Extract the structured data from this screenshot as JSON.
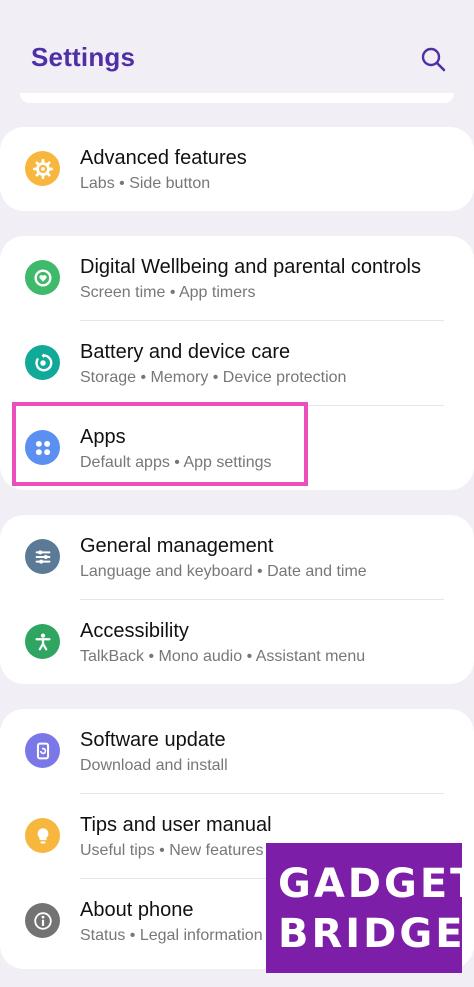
{
  "header": {
    "title": "Settings",
    "search_icon": "search-icon"
  },
  "colors": {
    "accent": "#4f2fa6",
    "highlight": "#ea4fbd",
    "logo_bg": "#7d1ea8"
  },
  "cards": [
    {
      "items": [
        {
          "title": "Advanced features",
          "subtitle": "Labs  •  Side button",
          "icon": "gear-icon",
          "color": "#f7b73f"
        }
      ]
    },
    {
      "items": [
        {
          "title": "Digital Wellbeing and parental controls",
          "subtitle": "Screen time  •  App timers",
          "icon": "wellbeing-icon",
          "color": "#3fb96a"
        },
        {
          "title": "Battery and device care",
          "subtitle": "Storage  •  Memory  •  Device protection",
          "icon": "battery-care-icon",
          "color": "#11a997"
        },
        {
          "title": "Apps",
          "subtitle": "Default apps  •  App settings",
          "icon": "apps-icon",
          "color": "#5b8ff0"
        }
      ]
    },
    {
      "items": [
        {
          "title": "General management",
          "subtitle": "Language and keyboard  •  Date and time",
          "icon": "sliders-icon",
          "color": "#5b7a96"
        },
        {
          "title": "Accessibility",
          "subtitle": "TalkBack  •  Mono audio  •  Assistant menu",
          "icon": "accessibility-icon",
          "color": "#2fa562"
        }
      ]
    },
    {
      "items": [
        {
          "title": "Software update",
          "subtitle": "Download and install",
          "icon": "update-icon",
          "color": "#7a77e8"
        },
        {
          "title": "Tips and user manual",
          "subtitle": "Useful tips  •  New features",
          "icon": "lightbulb-icon",
          "color": "#f7b73f"
        },
        {
          "title": "About phone",
          "subtitle": "Status  •  Legal information",
          "icon": "info-icon",
          "color": "#737373"
        }
      ]
    }
  ],
  "watermark": {
    "line1": "GADGET",
    "line2": "BRIDGE"
  }
}
